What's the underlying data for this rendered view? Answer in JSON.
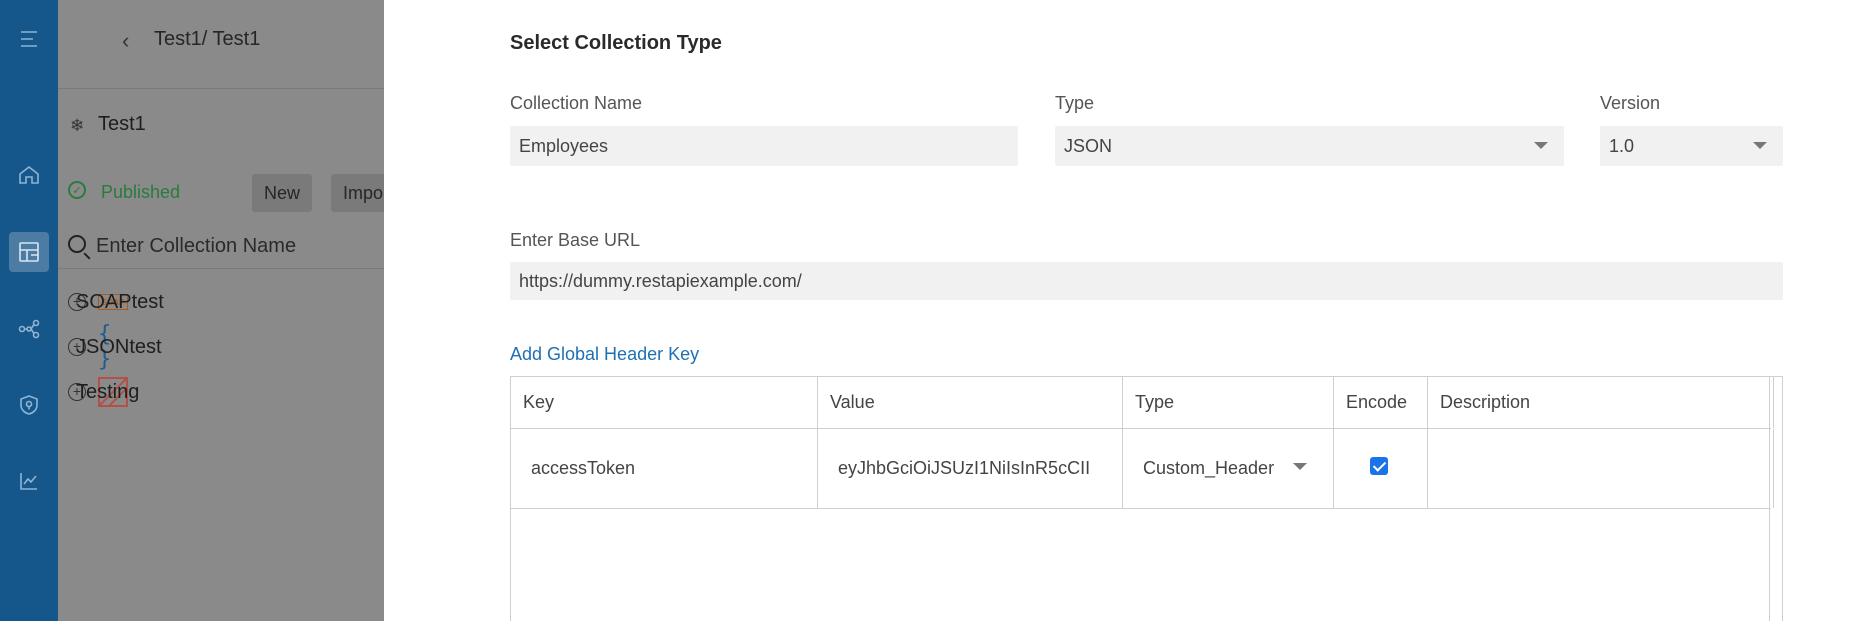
{
  "background": {
    "breadcrumb": "Test1/ Test1",
    "project_name": "Test1",
    "status": "Published",
    "buttons": [
      "New",
      "Impo"
    ],
    "search_placeholder": "Enter Collection Name",
    "collections": [
      {
        "label": "SOAPtest",
        "icon": "soap-icon",
        "icon_text": "SOAP"
      },
      {
        "label": "JSONtest",
        "icon": "json-braces-icon",
        "icon_text": "{ }"
      },
      {
        "label": "Testing",
        "icon": "testing-icon"
      }
    ]
  },
  "nav_rail": {
    "icons": [
      "menu-icon",
      "home-icon",
      "dashboard-icon",
      "share-network-icon",
      "shield-icon",
      "analytics-chart-icon"
    ],
    "active": "dashboard-icon"
  },
  "modal": {
    "title": "Select Collection Type",
    "collection_name": {
      "label": "Collection Name",
      "value": "Employees"
    },
    "type": {
      "label": "Type",
      "value": "JSON"
    },
    "version": {
      "label": "Version",
      "value": "1.0"
    },
    "base_url": {
      "label": "Enter Base URL",
      "value": "https://dummy.restapiexample.com/"
    },
    "add_header_link": "Add Global Header Key",
    "table": {
      "headers": {
        "key": "Key",
        "value": "Value",
        "type": "Type",
        "encode": "Encode",
        "description": "Description"
      },
      "rows": [
        {
          "key": "accessToken",
          "value": "eyJhbGciOiJSUzI1NiIsInR5cCII",
          "type": "Custom_Header",
          "encode": true,
          "description": ""
        }
      ]
    }
  },
  "colors": {
    "rail": "#15578b",
    "link": "#1f6fb4",
    "published": "#2b7a3e",
    "checkbox": "#1a73e8"
  }
}
